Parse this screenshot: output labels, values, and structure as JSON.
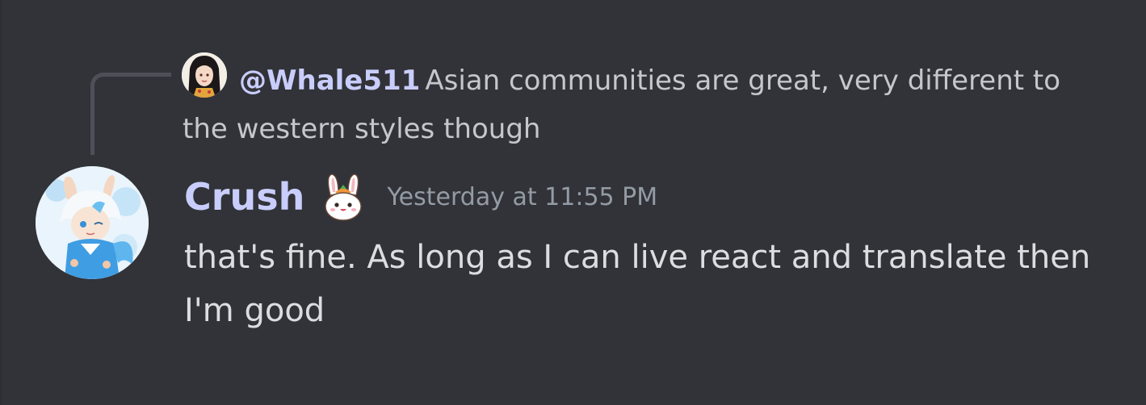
{
  "reply": {
    "mention": "@Whale511",
    "text": "Asian communities are great, very different to the western styles though",
    "avatar_icon": "girl-avatar-icon"
  },
  "message": {
    "author": "Crush",
    "author_color": "#c9cdfb",
    "role_icon": "bunny-icon",
    "timestamp": "Yesterday at 11:55 PM",
    "content": "that's fine. As long as I can live react and translate then I'm good",
    "avatar_icon": "anime-bunny-avatar-icon"
  },
  "colors": {
    "background": "#313338",
    "text": "#dbdee1",
    "muted": "#949ba4",
    "reply_text": "#c4c7cc",
    "spine": "#4e5058"
  }
}
